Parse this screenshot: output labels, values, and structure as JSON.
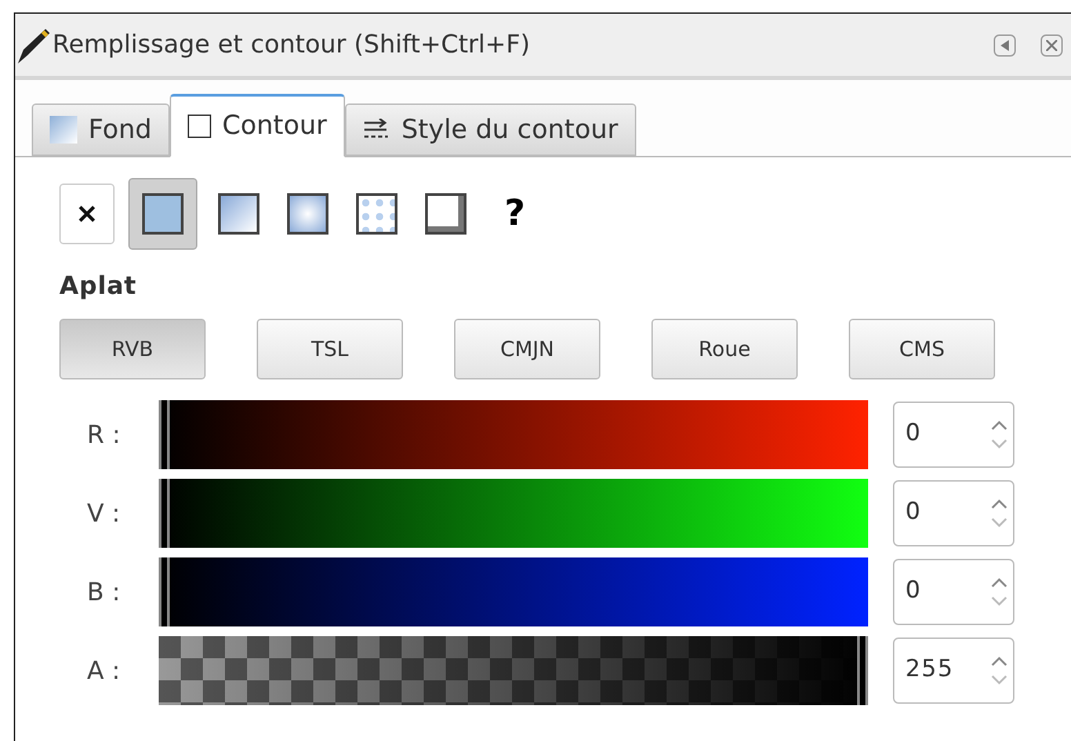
{
  "window": {
    "title": "Remplissage et contour (Shift+Ctrl+F)"
  },
  "tabs": [
    {
      "label": "Fond",
      "kind": "fill",
      "selected": false
    },
    {
      "label": "Contour",
      "kind": "stroke",
      "selected": true
    },
    {
      "label": "Style du contour",
      "kind": "style",
      "selected": false
    }
  ],
  "paint_types": [
    {
      "kind": "none",
      "selected": false
    },
    {
      "kind": "flat",
      "selected": true
    },
    {
      "kind": "linear",
      "selected": false
    },
    {
      "kind": "radial",
      "selected": false
    },
    {
      "kind": "pattern",
      "selected": false
    },
    {
      "kind": "swatch",
      "selected": false
    },
    {
      "kind": "unset",
      "label": "?",
      "selected": false
    }
  ],
  "section_title": "Aplat",
  "modes": [
    {
      "label": "RVB",
      "selected": true
    },
    {
      "label": "TSL",
      "selected": false
    },
    {
      "label": "CMJN",
      "selected": false
    },
    {
      "label": "Roue",
      "selected": false
    },
    {
      "label": "CMS",
      "selected": false
    }
  ],
  "channels": [
    {
      "label": "R :",
      "kind": "color",
      "color": "#ff2200",
      "level": 0,
      "value": "0"
    },
    {
      "label": "V :",
      "kind": "color",
      "color": "#11ff11",
      "level": 0,
      "value": "0"
    },
    {
      "label": "B :",
      "kind": "color",
      "color": "#0022ff",
      "level": 0,
      "value": "0"
    },
    {
      "label": "A :",
      "kind": "alpha",
      "color": "#000000",
      "level": 1,
      "value": "255"
    }
  ]
}
